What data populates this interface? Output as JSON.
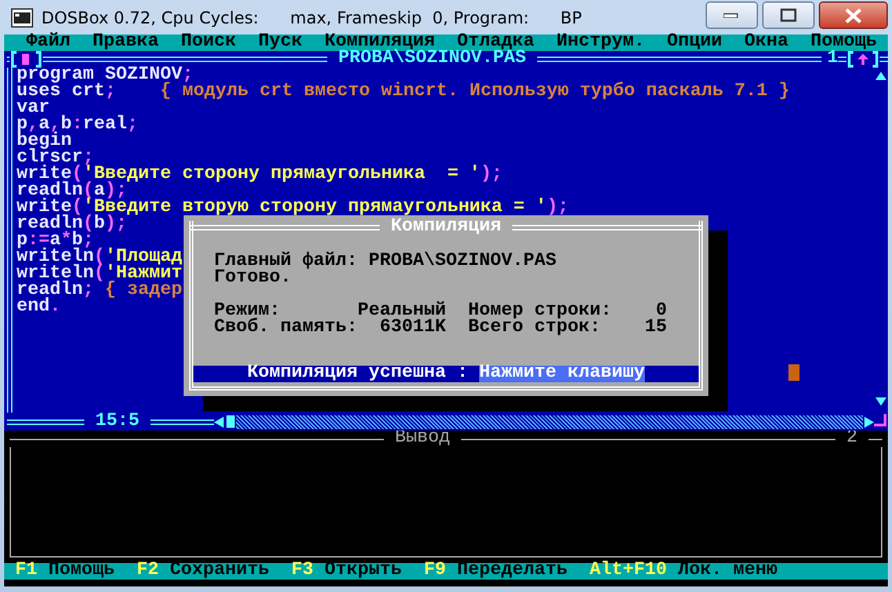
{
  "window": {
    "title": "DOSBox 0.72, Cpu Cycles:      max, Frameskip  0, Program:      BP"
  },
  "menu": [
    "Файл",
    "Правка",
    "Поиск",
    "Пуск",
    "Компиляция",
    "Отладка",
    "Инструм.",
    "Опции",
    "Окна",
    "Помощь"
  ],
  "editor": {
    "title": "PROBA\\SOZINOV.PAS",
    "window_number": "1",
    "position": "15:5",
    "lines": [
      [
        {
          "kind": "code",
          "text": "program SOZINOV"
        },
        {
          "kind": "sym",
          "text": ";"
        }
      ],
      [
        {
          "kind": "code",
          "text": "uses crt"
        },
        {
          "kind": "sym",
          "text": ";"
        },
        {
          "kind": "comment",
          "text": "    { модуль crt вместо wincrt. Использую турбо паскаль 7.1 }"
        }
      ],
      [
        {
          "kind": "code",
          "text": "var"
        }
      ],
      [
        {
          "kind": "code",
          "text": "p"
        },
        {
          "kind": "sym",
          "text": ","
        },
        {
          "kind": "code",
          "text": "a"
        },
        {
          "kind": "sym",
          "text": ","
        },
        {
          "kind": "code",
          "text": "b"
        },
        {
          "kind": "sym",
          "text": ":"
        },
        {
          "kind": "code",
          "text": "real"
        },
        {
          "kind": "sym",
          "text": ";"
        }
      ],
      [
        {
          "kind": "code",
          "text": "begin"
        }
      ],
      [
        {
          "kind": "code",
          "text": "clrscr"
        },
        {
          "kind": "sym",
          "text": ";"
        }
      ],
      [
        {
          "kind": "code",
          "text": "write"
        },
        {
          "kind": "sym",
          "text": "("
        },
        {
          "kind": "str",
          "text": "'Введите сторону прямаугольника  = '"
        },
        {
          "kind": "sym",
          "text": ");"
        }
      ],
      [
        {
          "kind": "code",
          "text": "readln"
        },
        {
          "kind": "sym",
          "text": "("
        },
        {
          "kind": "code",
          "text": "a"
        },
        {
          "kind": "sym",
          "text": ");"
        }
      ],
      [
        {
          "kind": "code",
          "text": "write"
        },
        {
          "kind": "sym",
          "text": "("
        },
        {
          "kind": "str",
          "text": "'Введите вторую сторону прямаугольника = '"
        },
        {
          "kind": "sym",
          "text": ");"
        }
      ],
      [
        {
          "kind": "code",
          "text": "readln"
        },
        {
          "kind": "sym",
          "text": "("
        },
        {
          "kind": "code",
          "text": "b"
        },
        {
          "kind": "sym",
          "text": ");"
        }
      ],
      [
        {
          "kind": "code",
          "text": "p"
        },
        {
          "kind": "sym",
          "text": ":="
        },
        {
          "kind": "code",
          "text": "a"
        },
        {
          "kind": "sym",
          "text": "*"
        },
        {
          "kind": "code",
          "text": "b"
        },
        {
          "kind": "sym",
          "text": ";"
        }
      ],
      [
        {
          "kind": "code",
          "text": "writeln"
        },
        {
          "kind": "sym",
          "text": "("
        },
        {
          "kind": "str",
          "text": "'Площад"
        }
      ],
      [
        {
          "kind": "code",
          "text": "writeln"
        },
        {
          "kind": "sym",
          "text": "("
        },
        {
          "kind": "str",
          "text": "'Нажмит"
        }
      ],
      [
        {
          "kind": "code",
          "text": "readln"
        },
        {
          "kind": "sym",
          "text": ";"
        },
        {
          "kind": "comment",
          "text": " { задер"
        }
      ],
      [
        {
          "kind": "code",
          "text": "end"
        },
        {
          "kind": "sym",
          "text": "."
        }
      ]
    ]
  },
  "dialog": {
    "title": "Компиляция",
    "main_file_label": "Главный файл:",
    "main_file": "PROBA\\SOZINOV.PAS",
    "status": "Готово.",
    "fields": [
      {
        "label": "Режим:",
        "value": "Реальный"
      },
      {
        "label": "Номер строки:",
        "value": "0"
      },
      {
        "label": "Своб. память:",
        "value": "63011K"
      },
      {
        "label": "Всего строк:",
        "value": "15"
      }
    ],
    "message": "Компиляция успешна : ",
    "prompt": "Нажмите клавишу"
  },
  "output": {
    "title": "Вывод",
    "window_number": "2"
  },
  "status_bar": [
    {
      "key": "F1",
      "label": "Помощь"
    },
    {
      "key": "F2",
      "label": "Сохранить"
    },
    {
      "key": "F3",
      "label": "Открыть"
    },
    {
      "key": "F9",
      "label": "Переделать"
    },
    {
      "key": "Alt+F10",
      "label": "Лок. меню"
    }
  ]
}
